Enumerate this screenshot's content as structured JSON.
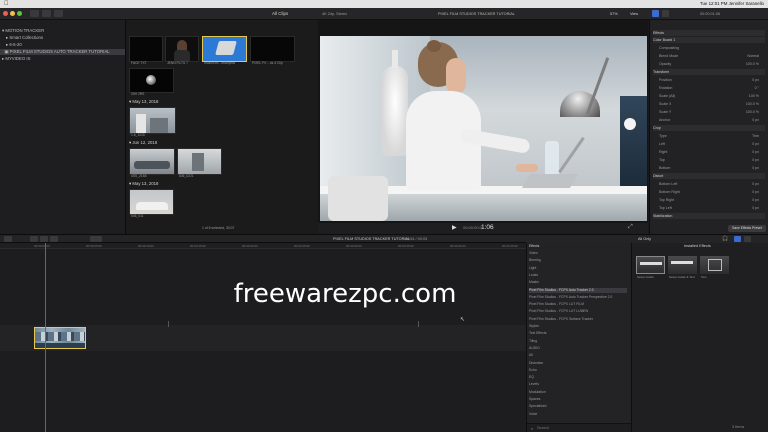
{
  "menubar": {
    "app": "Final Cut Pro",
    "items": [
      "File",
      "Edit",
      "Trim",
      "Mark",
      "Clip",
      "Modify",
      "View",
      "Window",
      "Help"
    ],
    "status": "Tue 12:01 PM   Jennifer Saranello"
  },
  "toolbar": {
    "browser_filter": "All Clips",
    "viewer_project": "4K 24p, Stereo",
    "viewer_title": "PIXEL FILM STUDIOS TRACKER TUTORIAL",
    "zoom": "57%",
    "view_menu": "View",
    "inspector_size": "00:00:01:06"
  },
  "sidebar": {
    "items": [
      {
        "label": "MOTION TRACKER"
      },
      {
        "label": "Smart Collections"
      },
      {
        "label": "6-5-20"
      },
      {
        "label": "PIXEL FILM STUDIOS AUTO TRACKER TUTORIAL"
      },
      {
        "label": "MYVIDEO IS"
      }
    ]
  },
  "browser": {
    "row1": [
      "FACE TXT",
      "JENN FILTS 7",
      "motion/on...trkBspmd",
      "PIXEL FX ...ck.4 Clip"
    ],
    "row1b": "00H 2RS",
    "date1": "May 13, 2018",
    "clip2": "1.6_1025",
    "date2": "Jun 12, 2018",
    "clip3a": "4SS_2168",
    "clip3b": "836_0221",
    "date3": "May 13, 2018",
    "clip4": "545_011",
    "footer": "1 of 8 selected, 30:07"
  },
  "viewer": {
    "timecode": "1:06"
  },
  "inspector": {
    "header": "Effects",
    "rows": [
      {
        "label": "Color Board 1",
        "value": "",
        "section": true
      },
      {
        "label": "Compositing",
        "value": "",
        "section": false
      },
      {
        "label": "Blend Mode",
        "value": "Normal",
        "section": false
      },
      {
        "label": "Opacity",
        "value": "100.0 %",
        "section": false
      },
      {
        "label": "Transform",
        "value": "",
        "section": true
      },
      {
        "label": "Position",
        "value": "0 px",
        "section": false
      },
      {
        "label": "Rotation",
        "value": "0 °",
        "section": false
      },
      {
        "label": "Scale (All)",
        "value": "100 %",
        "section": false
      },
      {
        "label": "Scale X",
        "value": "100.0 %",
        "section": false
      },
      {
        "label": "Scale Y",
        "value": "100.0 %",
        "section": false
      },
      {
        "label": "Anchor",
        "value": "0 px",
        "section": false
      },
      {
        "label": "Crop",
        "value": "",
        "section": true
      },
      {
        "label": "Type",
        "value": "Trim",
        "section": false
      },
      {
        "label": "Left",
        "value": "0 px",
        "section": false
      },
      {
        "label": "Right",
        "value": "0 px",
        "section": false
      },
      {
        "label": "Top",
        "value": "0 px",
        "section": false
      },
      {
        "label": "Bottom",
        "value": "0 px",
        "section": false
      },
      {
        "label": "Distort",
        "value": "",
        "section": true
      },
      {
        "label": "Bottom Left",
        "value": "0 px",
        "section": false
      },
      {
        "label": "Bottom Right",
        "value": "0 px",
        "section": false
      },
      {
        "label": "Top Right",
        "value": "0 px",
        "section": false
      },
      {
        "label": "Top Left",
        "value": "0 px",
        "section": false
      },
      {
        "label": "Stabilization",
        "value": "",
        "section": true
      }
    ],
    "save_button": "Save Effects Preset"
  },
  "timeline": {
    "title": "PIXEL FILM STUDIOS TRACKER TUTORIAL",
    "duration": "00:54 / 00:03",
    "ruler": [
      "00:00:00:00",
      "00:00:05:00",
      "00:00:10:00",
      "00:00:15:00",
      "00:00:20:00",
      "00:00:25:00",
      "00:00:30:00",
      "00:00:35:00",
      "00:00:40:00",
      "00:00:45:00"
    ]
  },
  "effects": {
    "header": "Effects",
    "list": [
      "Video",
      "Blurring",
      "Light",
      "Looks",
      "Masks",
      "Pixel Film Studios - FCPX Auto Tracker 2.0",
      "Pixel Film Studios - FCPX Auto Tracker Perspective 2.0",
      "Pixel Film Studios - FCPX LUT FILM",
      "Pixel Film Studios - FCPX LUT LUMEN",
      "Pixel Film Studios - FCPX Surface Tracker",
      "Stylize",
      "Text Effects",
      "Tiling",
      "AUDIO",
      "All",
      "Distortion",
      "Echo",
      "EQ",
      "Levels",
      "Modulation",
      "Spaces",
      "Specialized",
      "Voice"
    ],
    "grid_title": "All Only",
    "grid_filter": "Installed Effects",
    "tiles": [
      "Setup Guide",
      "Setup Guide & Text",
      "Text"
    ],
    "search_placeholder": "Search",
    "count": "3 Items"
  },
  "watermark": "freewarezpc.com"
}
